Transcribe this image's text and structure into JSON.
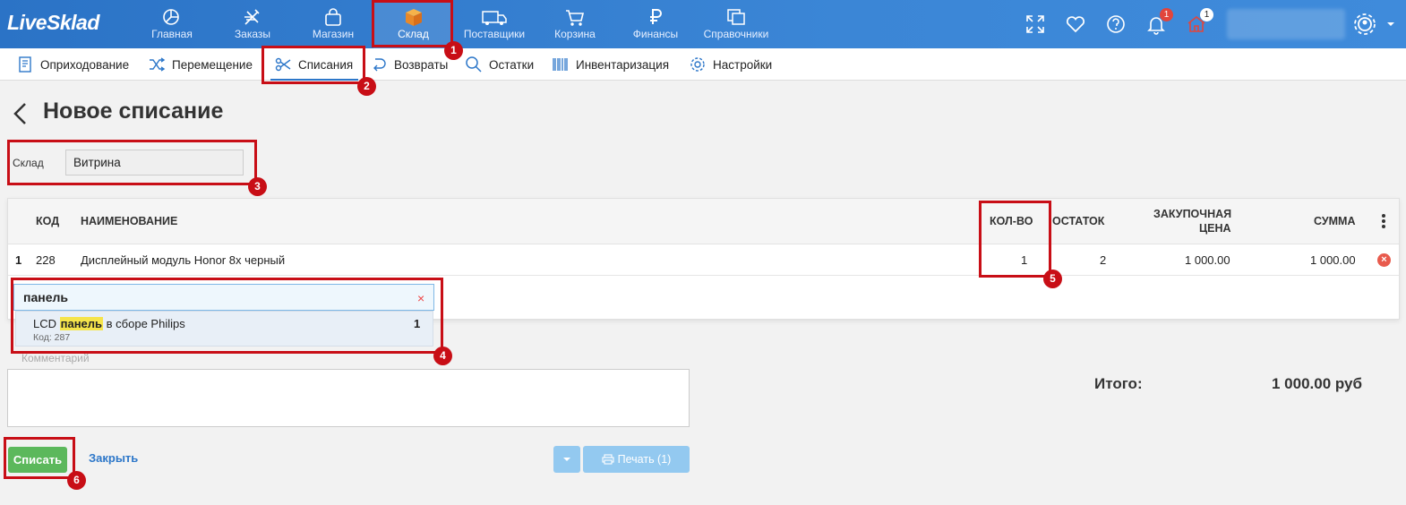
{
  "app": {
    "logo": "LiveSklad"
  },
  "main_nav": [
    {
      "label": "Главная",
      "icon": "pie-chart-icon"
    },
    {
      "label": "Заказы",
      "icon": "tools-icon"
    },
    {
      "label": "Магазин",
      "icon": "shopping-bag-icon"
    },
    {
      "label": "Склад",
      "icon": "box-icon",
      "active": true
    },
    {
      "label": "Поставщики",
      "icon": "truck-icon"
    },
    {
      "label": "Корзина",
      "icon": "cart-icon"
    },
    {
      "label": "Финансы",
      "icon": "ruble-icon"
    },
    {
      "label": "Справочники",
      "icon": "books-icon"
    }
  ],
  "top_right": {
    "notifications_badge": "1",
    "home_badge": "1"
  },
  "sub_nav": [
    {
      "label": "Оприходование",
      "icon": "receipt-icon"
    },
    {
      "label": "Перемещение",
      "icon": "shuffle-icon"
    },
    {
      "label": "Списания",
      "icon": "scissors-icon",
      "active": true
    },
    {
      "label": "Возвраты",
      "icon": "return-icon"
    },
    {
      "label": "Остатки",
      "icon": "search-icon"
    },
    {
      "label": "Инвентаризация",
      "icon": "barcode-icon"
    },
    {
      "label": "Настройки",
      "icon": "gear-icon"
    }
  ],
  "page": {
    "title": "Новое списание",
    "warehouse_label": "Склад",
    "warehouse_value": "Витрина"
  },
  "table": {
    "headers": {
      "code": "КОД",
      "name": "НАИМЕНОВАНИЕ",
      "qty": "КОЛ-ВО",
      "stock": "ОСТАТОК",
      "price_line1": "ЗАКУПОЧНАЯ",
      "price_line2": "ЦЕНА",
      "sum": "СУММА"
    },
    "rows": [
      {
        "num": "1",
        "code": "228",
        "name": "Дисплейный модуль Honor 8x черный",
        "qty": "1",
        "stock": "2",
        "price": "1 000.00",
        "sum": "1 000.00"
      }
    ]
  },
  "search": {
    "value": "панель",
    "clear": "×",
    "result": {
      "name_before": "LCD ",
      "name_highlight": "панель",
      "name_after": " в сборе Philips",
      "code": "Код: 287",
      "qty": "1"
    }
  },
  "comment": {
    "label": "Комментарий"
  },
  "totals": {
    "label": "Итого:",
    "value": "1 000.00 руб"
  },
  "actions": {
    "submit": "Списать",
    "close": "Закрыть",
    "print": "Печать (1)"
  },
  "annotations": [
    "1",
    "2",
    "3",
    "4",
    "5",
    "6"
  ],
  "colors": {
    "topbar": "#3b86d6",
    "accent": "#2d77c9",
    "submit": "#5cb85c",
    "annotation": "#c80e16",
    "highlight": "#f5e44b"
  }
}
